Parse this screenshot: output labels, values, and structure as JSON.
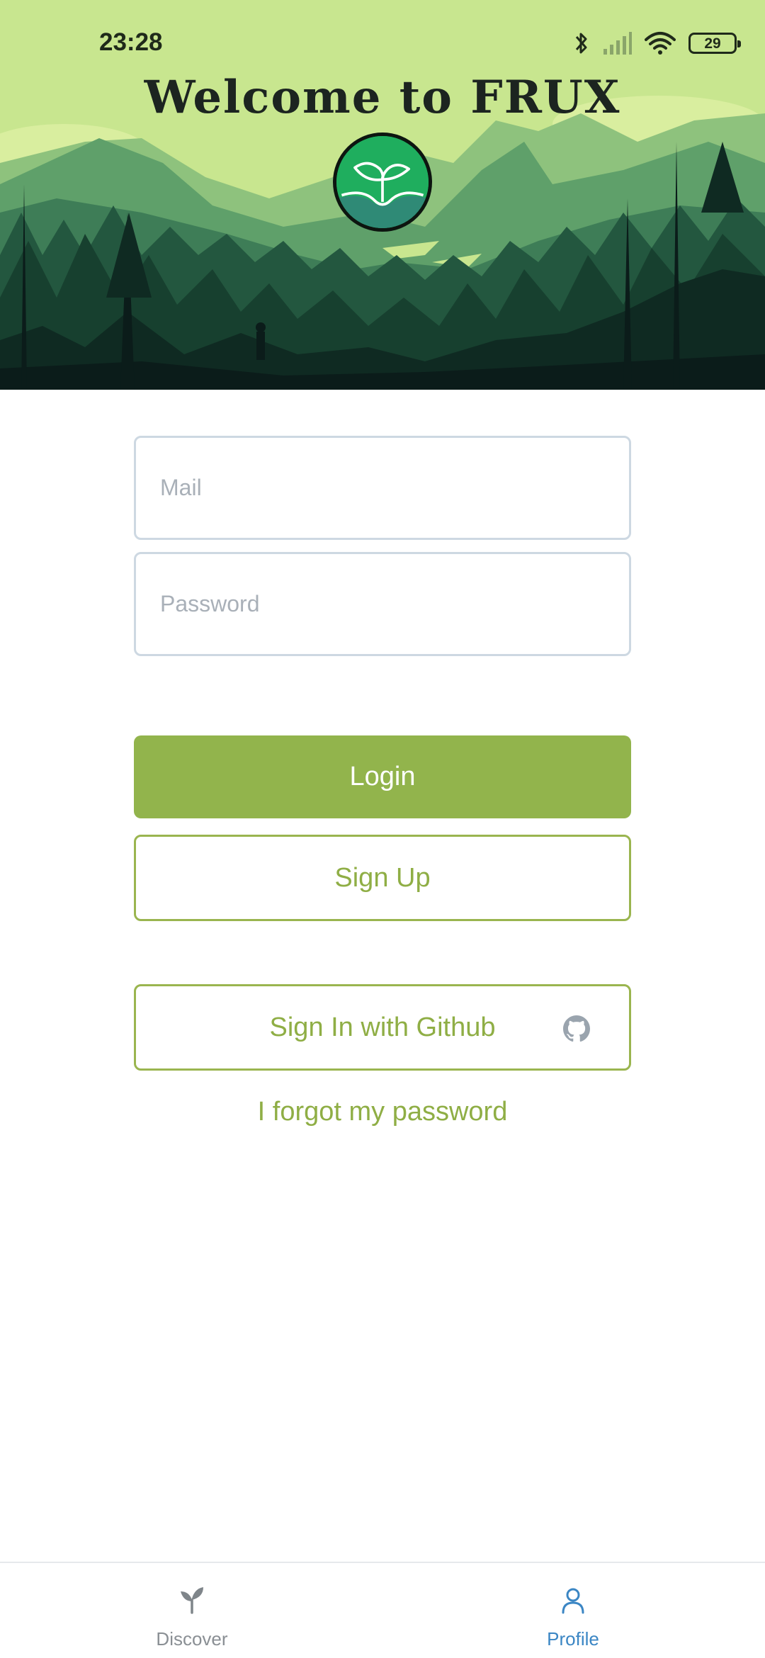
{
  "status_bar": {
    "time": "23:28",
    "battery_level": "29",
    "icons": [
      "bluetooth-icon",
      "signal-icon",
      "wifi-icon",
      "battery-icon"
    ]
  },
  "header": {
    "title": "Welcome to FRUX",
    "logo_icon": "sprout-logo-icon"
  },
  "login_form": {
    "mail_placeholder": "Mail",
    "password_placeholder": "Password",
    "login_label": "Login",
    "signup_label": "Sign Up",
    "github_label": "Sign In with Github",
    "github_icon": "github-icon",
    "forgot_label": "I forgot my password"
  },
  "bottom_nav": {
    "items": [
      {
        "label": "Discover",
        "icon": "sprout-icon",
        "active": false
      },
      {
        "label": "Profile",
        "icon": "user-icon",
        "active": true
      }
    ]
  },
  "colors": {
    "accent": "#92b44c",
    "accent_text": "#8fae45",
    "active_nav": "#3b86c4",
    "inactive_nav": "#8a8f94",
    "sky": "#c8e68f"
  }
}
